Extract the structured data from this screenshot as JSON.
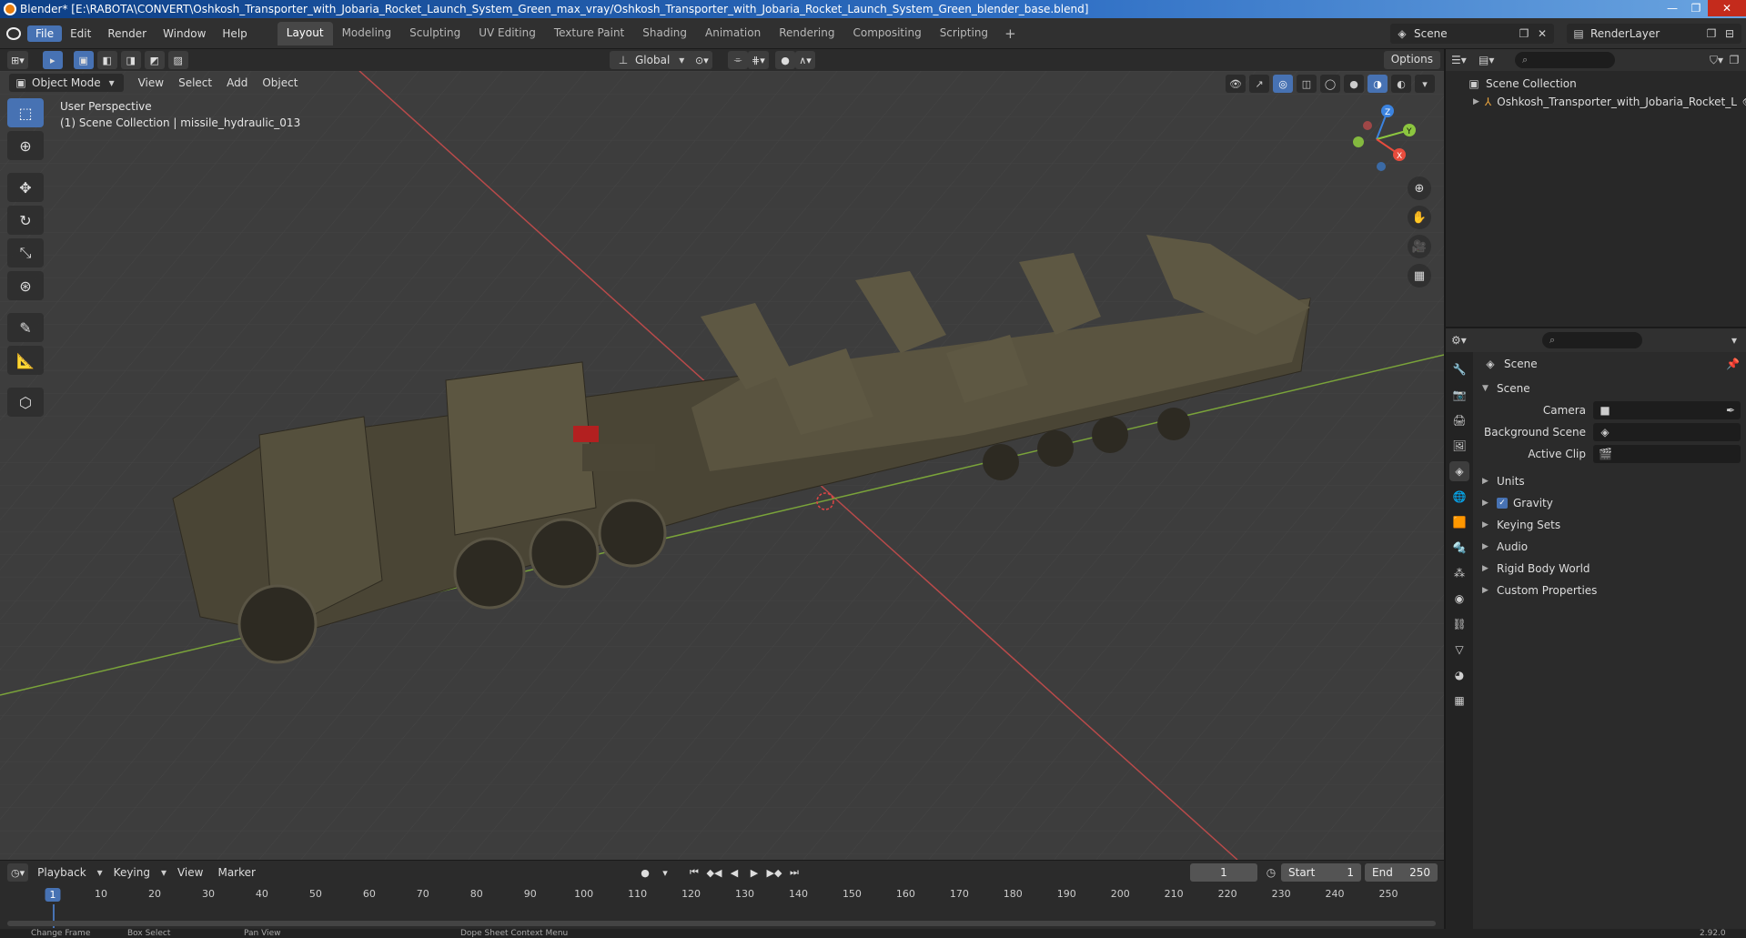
{
  "window": {
    "title": "Blender* [E:\\RABOTA\\CONVERT\\Oshkosh_Transporter_with_Jobaria_Rocket_Launch_System_Green_max_vray/Oshkosh_Transporter_with_Jobaria_Rocket_Launch_System_Green_blender_base.blend]",
    "min": "—",
    "max": "❐",
    "close": "✕"
  },
  "menu": [
    "File",
    "Edit",
    "Render",
    "Window",
    "Help"
  ],
  "workspaces": [
    "Layout",
    "Modeling",
    "Sculpting",
    "UV Editing",
    "Texture Paint",
    "Shading",
    "Animation",
    "Rendering",
    "Compositing",
    "Scripting"
  ],
  "workspace_add": "+",
  "scene": {
    "name": "Scene",
    "layer": "RenderLayer"
  },
  "toolrow": {
    "transform": "Global",
    "options": "Options"
  },
  "viewport": {
    "mode": "Object Mode",
    "menus": [
      "View",
      "Select",
      "Add",
      "Object"
    ],
    "perspective": "User Perspective",
    "collection_info": "(1) Scene Collection | missile_hydraulic_013",
    "gizmo": {
      "z": "Z",
      "y": "Y",
      "x": "X"
    }
  },
  "timeline": {
    "menus": [
      "Playback",
      "Keying",
      "View",
      "Marker"
    ],
    "current_frame": "1",
    "start_label": "Start",
    "start": "1",
    "end_label": "End",
    "end": "250",
    "ticks": [
      "1",
      "10",
      "20",
      "30",
      "40",
      "50",
      "60",
      "70",
      "80",
      "90",
      "100",
      "110",
      "120",
      "130",
      "140",
      "150",
      "160",
      "170",
      "180",
      "190",
      "200",
      "210",
      "220",
      "230",
      "240",
      "250"
    ]
  },
  "status": {
    "left": "Change Frame",
    "mid1": "Box Select",
    "mid2": "Pan View",
    "mid3": "Dope Sheet Context Menu",
    "version": "2.92.0"
  },
  "outliner": {
    "root": "Scene Collection",
    "item": "Oshkosh_Transporter_with_Jobaria_Rocket_L"
  },
  "properties": {
    "title": "Scene",
    "panel": "Scene",
    "fields": [
      {
        "label": "Camera",
        "value": ""
      },
      {
        "label": "Background Scene",
        "value": ""
      },
      {
        "label": "Active Clip",
        "value": ""
      }
    ],
    "subpanels": [
      "Units",
      "Gravity",
      "Keying Sets",
      "Audio",
      "Rigid Body World",
      "Custom Properties"
    ]
  },
  "colors": {
    "accent": "#4772b3",
    "axis_x": "#e84c3d",
    "axis_y": "#8cc63f",
    "axis_z": "#3b83e0"
  }
}
